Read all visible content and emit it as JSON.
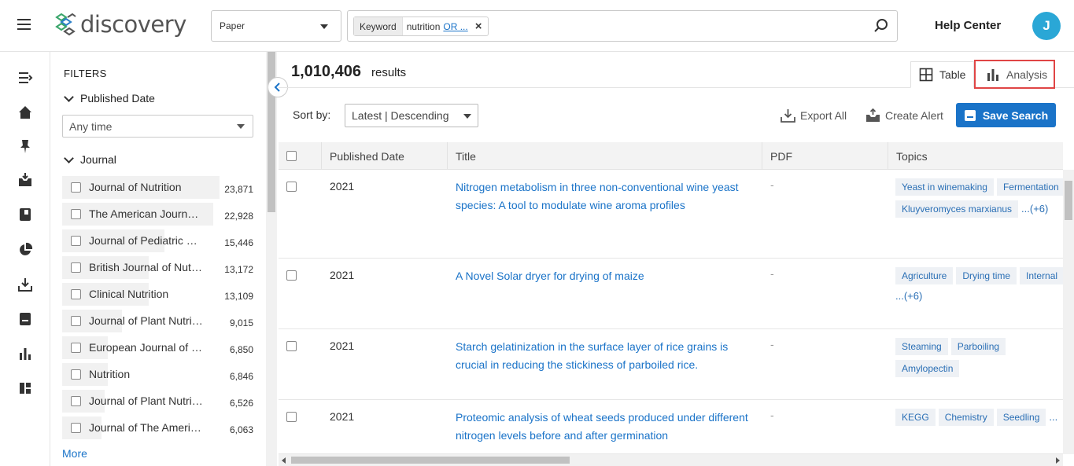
{
  "header": {
    "logo_text": "discovery",
    "type_select": "Paper",
    "search_chip": {
      "key": "Keyword",
      "value": "nutrition",
      "link": "OR ..."
    },
    "help_center": "Help Center",
    "avatar_initial": "J"
  },
  "filters": {
    "title": "FILTERS",
    "published_date": {
      "label": "Published Date",
      "value": "Any time"
    },
    "journal": {
      "label": "Journal",
      "items": [
        {
          "name": "Journal of Nutrition",
          "count": "23,871",
          "fraction": 1.0
        },
        {
          "name": "The American Journal of Clinical Nutrition",
          "count": "22,928",
          "fraction": 0.96
        },
        {
          "name": "Journal of Pediatric Gastroenterology and Nutrition",
          "count": "15,446",
          "fraction": 0.65
        },
        {
          "name": "British Journal of Nutrition",
          "count": "13,172",
          "fraction": 0.55
        },
        {
          "name": "Clinical Nutrition",
          "count": "13,109",
          "fraction": 0.55
        },
        {
          "name": "Journal of Plant Nutrition",
          "count": "9,015",
          "fraction": 0.38
        },
        {
          "name": "European Journal of Clinical Nutrition",
          "count": "6,850",
          "fraction": 0.29
        },
        {
          "name": "Nutrition",
          "count": "6,846",
          "fraction": 0.29
        },
        {
          "name": "Journal of Plant Nutrition and Soil Science",
          "count": "6,526",
          "fraction": 0.27
        },
        {
          "name": "Journal of The American Dietetic Association",
          "count": "6,063",
          "fraction": 0.25
        }
      ],
      "more": "More"
    }
  },
  "main": {
    "results_count": "1,010,406",
    "results_label": "results",
    "tabs": {
      "table": "Table",
      "analysis": "Analysis"
    },
    "sort_label": "Sort by:",
    "sort_value": "Latest | Descending",
    "export_all": "Export All",
    "create_alert": "Create Alert",
    "save_search": "Save Search",
    "columns": [
      "Published Date",
      "Title",
      "PDF",
      "Topics"
    ],
    "rows": [
      {
        "year": "2021",
        "title": "Nitrogen metabolism in three non-conventional wine yeast species: A tool to modulate wine aroma profiles",
        "pdf": "-",
        "topics": [
          "Yeast in winemaking",
          "Fermentation",
          "Kluyveromyces marxianus"
        ],
        "more": "...(+6)"
      },
      {
        "year": "2021",
        "title": "A Novel Solar dryer for drying of maize",
        "pdf": "-",
        "topics": [
          "Agriculture",
          "Drying time",
          "Internal"
        ],
        "more": "...(+6)"
      },
      {
        "year": "2021",
        "title": "Starch gelatinization in the surface layer of rice grains is crucial in reducing the stickiness of parboiled rice.",
        "pdf": "-",
        "topics": [
          "Steaming",
          "Parboiling",
          "Amylopectin"
        ],
        "more": ""
      },
      {
        "year": "2021",
        "title": "Proteomic analysis of wheat seeds produced under different nitrogen levels before and after germination",
        "pdf": "-",
        "topics": [
          "KEGG",
          "Chemistry",
          "Seedling"
        ],
        "more": "..."
      }
    ]
  }
}
